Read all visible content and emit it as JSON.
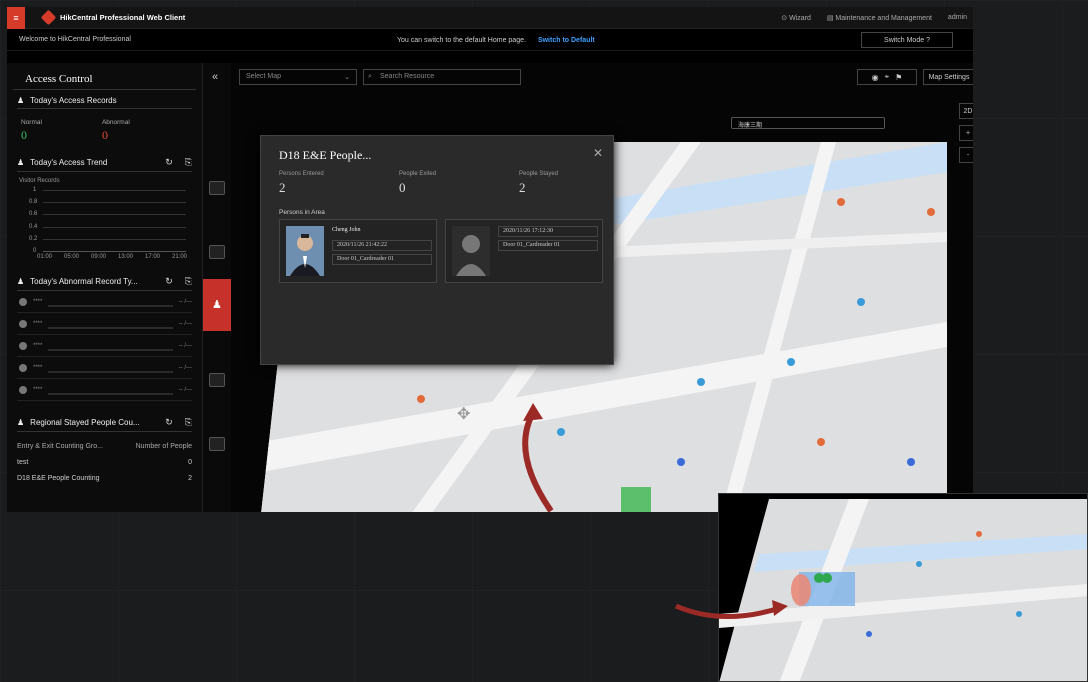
{
  "topbar": {
    "app_name": "HikCentral Professional Web Client",
    "wizard": "Wizard",
    "maintenance": "Maintenance and Management",
    "user": "admin"
  },
  "subbar": {
    "welcome": "Welcome to HikCentral Professional",
    "notice": "You can switch to the default Home page.",
    "link": "Switch to Default",
    "switch_mode": "Switch Mode"
  },
  "sidebar": {
    "title": "Access Control",
    "records": {
      "title": "Today's Access Records",
      "normal_label": "Normal",
      "normal_value": "0",
      "abnormal_label": "Abnormal",
      "abnormal_value": "0"
    },
    "trend": {
      "title": "Today's Access Trend",
      "ylabel": "Visitor Records",
      "yticks": [
        "1",
        "0.8",
        "0.6",
        "0.4",
        "0.2",
        "0"
      ],
      "xticks": [
        "01:00",
        "05:00",
        "09:00",
        "13:00",
        "17:00",
        "21:00"
      ]
    },
    "abnormal": {
      "title": "Today's Abnormal Record Ty...",
      "rows": [
        {
          "label": "****",
          "value": "-- /---"
        },
        {
          "label": "****",
          "value": "-- /---"
        },
        {
          "label": "****",
          "value": "-- /---"
        },
        {
          "label": "****",
          "value": "-- /---"
        },
        {
          "label": "****",
          "value": "-- /---"
        }
      ]
    },
    "regional": {
      "title": "Regional Stayed People Cou...",
      "col1": "Entry & Exit Counting Gro...",
      "col2": "Number of People",
      "rows": [
        {
          "name": "test",
          "count": "0"
        },
        {
          "name": "D18 E&E People Counting",
          "count": "2"
        }
      ]
    }
  },
  "toolbar": {
    "select_map": "Select Map",
    "search": "Search Resource",
    "map_settings": "Map Settings",
    "view_2d": "2D",
    "zoom_in": "+",
    "zoom_out": "-",
    "floor": "海康三期"
  },
  "popup": {
    "title": "D18 E&E People...",
    "entered_label": "Persons Entered",
    "entered": "2",
    "exited_label": "People Exited",
    "exited": "0",
    "stayed_label": "People Stayed",
    "stayed": "2",
    "area_label": "Persons in Area",
    "persons": [
      {
        "name": "Cheng John",
        "time": "2020/11/26 21:42:22",
        "door": "Door 01_Cardreader 01"
      },
      {
        "name": "",
        "time": "2020/11/26 17:12:30",
        "door": "Door 01_Cardreader 01"
      }
    ]
  },
  "colors": {
    "accent": "#d63b2a",
    "link": "#3fa0ff",
    "normal": "#35c25b",
    "abnormal": "#e24a3a"
  }
}
